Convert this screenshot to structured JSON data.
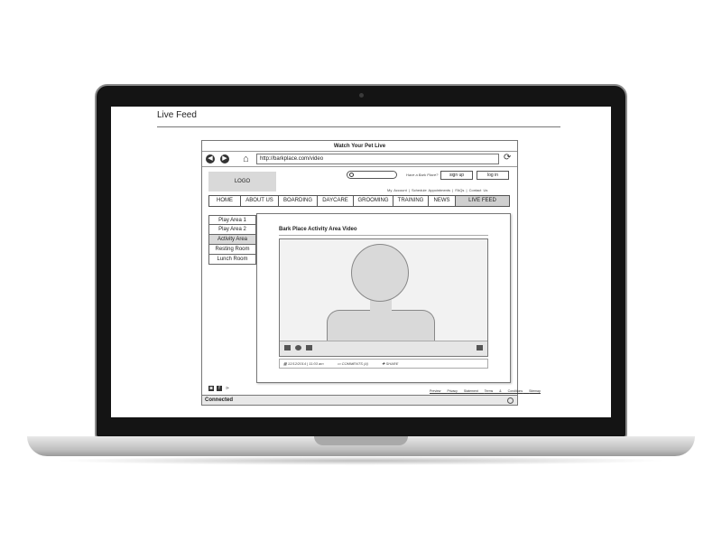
{
  "page": {
    "title": "Live Feed"
  },
  "browser": {
    "window_title": "Watch Your Pet Live",
    "url": "http://barkplace.com/video",
    "status": "Connected",
    "icons": [
      "back-icon",
      "forward-icon",
      "home-icon",
      "refresh-icon"
    ]
  },
  "site": {
    "logo": "LOGO",
    "member_prompt": "Have a Bark Place?",
    "sign_up": "sign up",
    "log_in": "log in",
    "util_links": [
      "My Account",
      "|",
      "Schedule Appointments",
      "|",
      "FAQs",
      "|",
      "Contact Us"
    ],
    "nav": [
      "HOME",
      "ABOUT US",
      "BOARDING",
      "DAYCARE",
      "GROOMING",
      "TRAINING",
      "NEWS",
      "LIVE FEED"
    ],
    "side": [
      "Play Area 1",
      "Play Area 2",
      "Activity Area",
      "Resting Room",
      "Lunch Room"
    ],
    "active_side": "Activity Area",
    "footer_links": [
      "Preview",
      "Privacy Statement",
      "Terms & Conditions",
      "Sitemap"
    ]
  },
  "video": {
    "title": "Bark Place Activity Area Video",
    "date": "12/12/2014",
    "time": "11:03 am",
    "comments": "COMMENTS (4)",
    "share": "SHARE"
  }
}
